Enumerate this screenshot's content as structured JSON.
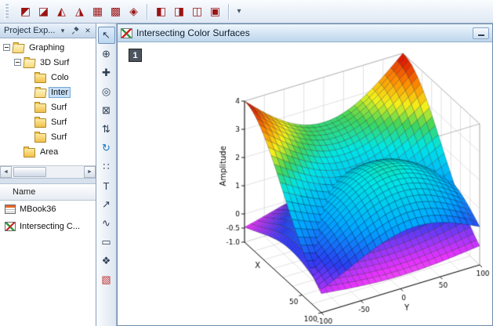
{
  "toolbar_top": {
    "buttons": [
      {
        "name": "3d-scatter",
        "glyph": "◩"
      },
      {
        "name": "3d-trajectory",
        "glyph": "◪"
      },
      {
        "name": "3d-bars",
        "glyph": "◭"
      },
      {
        "name": "3d-ribbons",
        "glyph": "◮"
      },
      {
        "name": "3d-walls",
        "glyph": "▦"
      },
      {
        "name": "3d-waterfall",
        "glyph": "▩"
      },
      {
        "name": "3d-surface",
        "glyph": "◈"
      },
      {
        "name": "contour-color-fill",
        "glyph": "◧"
      },
      {
        "name": "contour-lines",
        "glyph": "◨"
      },
      {
        "name": "gray-scale-map",
        "glyph": "◫"
      },
      {
        "name": "image-plot",
        "glyph": "▣"
      }
    ],
    "overflow_glyph": "▾"
  },
  "project_explorer": {
    "title": "Project Exp...",
    "header_icons": {
      "chevron_down": "▾",
      "close": "✕"
    },
    "tree": [
      {
        "label": "Graphing"
      },
      {
        "label": "3D Surf"
      },
      {
        "label": "Colo"
      },
      {
        "label": "Inter"
      },
      {
        "label": "Surf"
      },
      {
        "label": "Surf"
      },
      {
        "label": "Surf"
      },
      {
        "label": "Area"
      }
    ],
    "hscroll_icons": {
      "left": "◄",
      "right": "►"
    },
    "files_header": "Name",
    "files": [
      {
        "label": "MBook36"
      },
      {
        "label": "Intersecting C..."
      }
    ]
  },
  "tools": {
    "buttons": [
      {
        "name": "pointer-tool",
        "glyph": "↖"
      },
      {
        "name": "zoom-tool",
        "glyph": "⊕"
      },
      {
        "name": "data-reader-tool",
        "glyph": "✚"
      },
      {
        "name": "screen-reader-tool",
        "glyph": "◎"
      },
      {
        "name": "mask-tool",
        "glyph": "⊠"
      },
      {
        "name": "draw-data-tool",
        "glyph": "⇅"
      },
      {
        "name": "rotate-3d-tool",
        "glyph": "↻"
      },
      {
        "name": "region-select-tool",
        "glyph": "∷"
      },
      {
        "name": "text-tool",
        "glyph": "T"
      },
      {
        "name": "arrow-tool",
        "glyph": "↗"
      },
      {
        "name": "curve-tool",
        "glyph": "∿"
      },
      {
        "name": "rectangle-tool",
        "glyph": "▭"
      },
      {
        "name": "pan-tool",
        "glyph": "❖"
      },
      {
        "name": "insert-graph-tool",
        "glyph": "▧"
      }
    ]
  },
  "window": {
    "title": "Intersecting Color Surfaces",
    "layer_badge": "1"
  },
  "chart_data": {
    "type": "surface3d",
    "title": "Intersecting Color Surfaces",
    "x_label": "X",
    "y_label": "Y",
    "z_label": "Amplitude",
    "x_range": [
      -100,
      100
    ],
    "y_range": [
      -100,
      100
    ],
    "z_range": [
      -1,
      4
    ],
    "x_ticks": [
      {
        "v": 50,
        "label": "50"
      },
      {
        "v": 100,
        "label": "100"
      }
    ],
    "y_ticks": [
      {
        "v": -100,
        "label": "-100"
      },
      {
        "v": -50,
        "label": "-50"
      },
      {
        "v": 0,
        "label": "0"
      },
      {
        "v": 50,
        "label": "50"
      },
      {
        "v": 100,
        "label": "100"
      }
    ],
    "z_ticks": [
      {
        "v": 4,
        "label": "4"
      },
      {
        "v": 3,
        "label": "3"
      },
      {
        "v": 2,
        "label": "2"
      },
      {
        "v": 1,
        "label": "1"
      },
      {
        "v": 0,
        "label": "0"
      },
      {
        "v": -0.5,
        "label": "-0.5"
      },
      {
        "v": -1,
        "label": "-1.0"
      }
    ],
    "grid_step": 25,
    "mesh_divisions": 26,
    "colormap": [
      [
        -1,
        "#ff90d8"
      ],
      [
        -0.4,
        "#e632ff"
      ],
      [
        0.3,
        "#2a3cf0"
      ],
      [
        1.1,
        "#00a8ff"
      ],
      [
        2.0,
        "#00e6e6"
      ],
      [
        2.5,
        "#3fd45a"
      ],
      [
        2.95,
        "#f2f21a"
      ],
      [
        3.45,
        "#ff8c00"
      ],
      [
        4,
        "#d80000"
      ]
    ],
    "surfaces": [
      {
        "name": "ridge-surface",
        "formula": "z = -1 + (5 - 1.6*sin(pi*(y+100)/200)) * exp(-((x+100)^2)/20000)"
      },
      {
        "name": "dome-surface",
        "formula": "z = -0.85 + 3.0*exp(-(((x-20)^2)+((y-20)^2))/14000)"
      }
    ],
    "legend": "none",
    "grid": true
  }
}
